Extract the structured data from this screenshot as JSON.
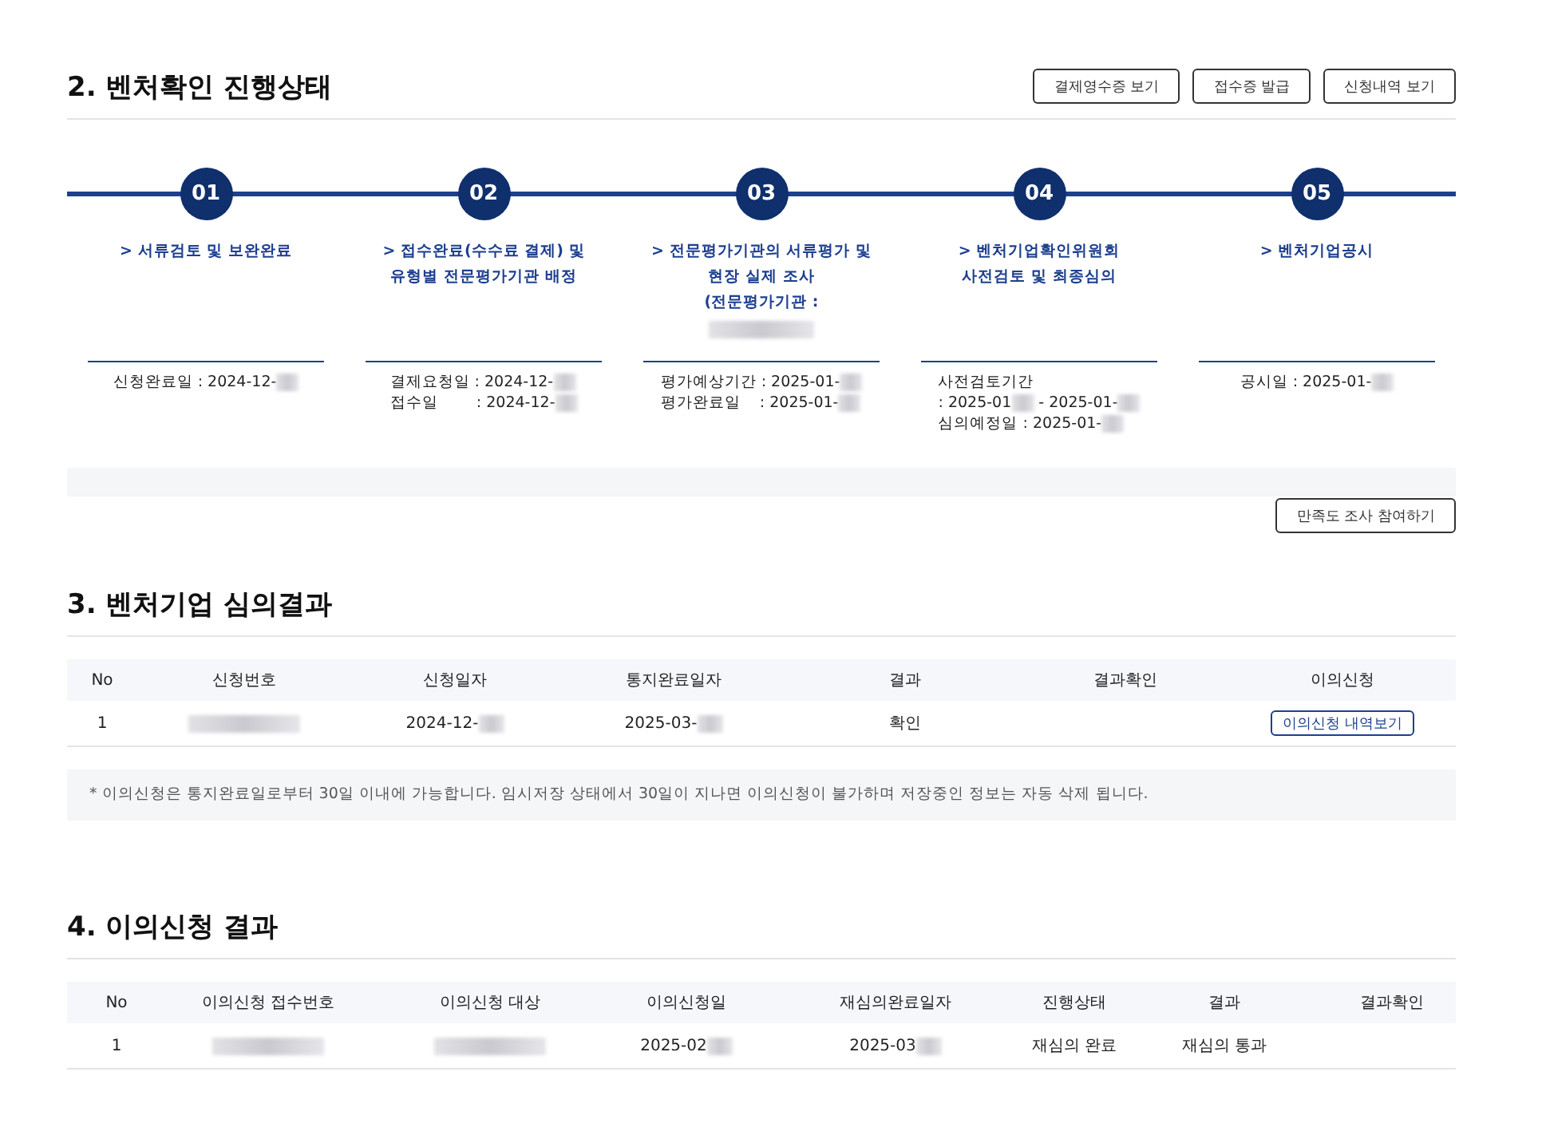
{
  "progress": {
    "title": "2. 벤처확인 진행상태",
    "buttons": [
      "결제영수증 보기",
      "접수증 발급",
      "신청내역 보기"
    ],
    "steps": [
      {
        "number": "01",
        "title_lines": [
          "> 서류검토 및 보완완료"
        ],
        "title_redacted": false,
        "info": [
          [
            {
              "text": "신청완료일 : 2024-12-",
              "redacted": true
            }
          ]
        ]
      },
      {
        "number": "02",
        "title_lines": [
          "> 접수완료(수수료 결제) 및",
          "유형별 전문평가기관 배정"
        ],
        "title_redacted": false,
        "info": [
          [
            {
              "text": "결제요청일 : 2024-12-",
              "redacted": true
            }
          ],
          [
            {
              "text": "접수일        : 2024-12-",
              "redacted": true
            }
          ]
        ]
      },
      {
        "number": "03",
        "title_lines": [
          "> 전문평가기관의 서류평가 및",
          "현장 실제 조사",
          "(전문평가기관 :"
        ],
        "title_redacted": true,
        "info": [
          [
            {
              "text": "평가예상기간 : 2025-01-",
              "redacted": true
            }
          ],
          [
            {
              "text": "평가완료일    : 2025-01-",
              "redacted": true
            }
          ]
        ]
      },
      {
        "number": "04",
        "title_lines": [
          "> 벤처기업확인위원회",
          "사전검토 및 최종심의"
        ],
        "title_redacted": false,
        "info": [
          [
            {
              "text": "사전검토기간",
              "redacted": false
            }
          ],
          [
            {
              "text": ": 2025-01",
              "redacted": true
            },
            {
              "text": " - 2025-01-",
              "redacted": true
            }
          ],
          [
            {
              "text": "심의예정일 : 2025-01-",
              "redacted": true
            }
          ]
        ]
      },
      {
        "number": "05",
        "title_lines": [
          "> 벤처기업공시"
        ],
        "title_redacted": false,
        "info": [
          [
            {
              "text": "공시일 : 2025-01-",
              "redacted": true
            }
          ]
        ]
      }
    ],
    "survey_button": "만족도 조사 참여하기"
  },
  "review": {
    "title": "3. 벤처기업 심의결과",
    "columns": [
      "No",
      "신청번호",
      "신청일자",
      "통지완료일자",
      "결과",
      "결과확인",
      "이의신청"
    ],
    "rows": [
      {
        "cells": [
          {
            "kind": "text",
            "text": "1",
            "redacted": false
          },
          {
            "kind": "text",
            "redacted": true
          },
          {
            "kind": "text",
            "text": "2024-12-",
            "redacted": true
          },
          {
            "kind": "text",
            "text": "2025-03-",
            "redacted": true
          },
          {
            "kind": "text",
            "text": "확인",
            "redacted": false
          },
          {
            "kind": "empty"
          },
          {
            "kind": "button",
            "text": "이의신청 내역보기"
          }
        ]
      }
    ],
    "note": "* 이의신청은 통지완료일로부터 30일 이내에 가능합니다. 임시저장 상태에서 30일이 지나면 이의신청이 불가하며 저장중인 정보는 자동 삭제 됩니다."
  },
  "objection": {
    "title": "4. 이의신청 결과",
    "columns": [
      "No",
      "이의신청 접수번호",
      "이의신청 대상",
      "이의신청일",
      "재심의완료일자",
      "진행상태",
      "결과",
      "결과확인"
    ],
    "rows": [
      {
        "cells": [
          {
            "kind": "text",
            "text": "1",
            "redacted": false
          },
          {
            "kind": "text",
            "redacted": true
          },
          {
            "kind": "text",
            "redacted": true
          },
          {
            "kind": "text",
            "text": "2025-02",
            "redacted": true
          },
          {
            "kind": "text",
            "text": "2025-03",
            "redacted": true
          },
          {
            "kind": "text",
            "text": "재심의 완료",
            "redacted": false
          },
          {
            "kind": "text",
            "text": "재심의 통과",
            "redacted": false
          },
          {
            "kind": "empty"
          }
        ]
      }
    ]
  }
}
